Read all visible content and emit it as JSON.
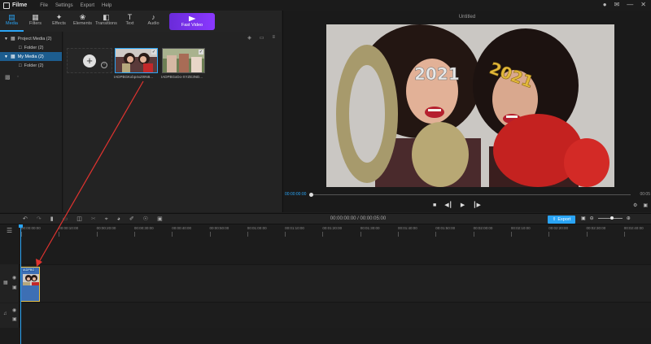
{
  "app": {
    "name": "Filme"
  },
  "menu": [
    "File",
    "Settings",
    "Export",
    "Help"
  ],
  "window_controls": [
    "user-icon",
    "mail-icon",
    "minimize-icon",
    "close-icon"
  ],
  "tabs": [
    {
      "label": "Media",
      "icon": "media-icon",
      "active": true
    },
    {
      "label": "Filters",
      "icon": "filters-icon",
      "active": false
    },
    {
      "label": "Effects",
      "icon": "effects-icon",
      "active": false
    },
    {
      "label": "Elements",
      "icon": "elements-icon",
      "active": false
    },
    {
      "label": "Transitions",
      "icon": "transitions-icon",
      "active": false
    },
    {
      "label": "Text",
      "icon": "text-icon",
      "active": false
    },
    {
      "label": "Audio",
      "icon": "audio-icon",
      "active": false
    }
  ],
  "fast_video": {
    "label": "Fast Video"
  },
  "tree": {
    "project_media": "Project Media (2)",
    "project_folder": "Folder (2)",
    "my_media": "My Media (2)",
    "my_folder": "Folder (2)"
  },
  "media": {
    "clips": [
      {
        "label": "IADPBGKxbp4xZI9N8..."
      },
      {
        "label": "IADPBGxDo-XYZE3ND..."
      }
    ]
  },
  "preview": {
    "title": "Untitled",
    "time_current": "00:00:00:00",
    "time_end": "00:05"
  },
  "timeline": {
    "time_display": "00:00:00:00 / 00:00:05:00",
    "export_label": "Export",
    "ruler": [
      "00:00:00:00",
      "00:00:10:00",
      "00:00:20:00",
      "00:00:30:00",
      "00:00:40:00",
      "00:00:50:00",
      "00:01:00:00",
      "00:01:10:00",
      "00:01:20:00",
      "00:01:30:00",
      "00:01:40:00",
      "00:01:50:00",
      "00:02:00:00",
      "00:02:10:00",
      "00:02:20:00",
      "00:02:30:00",
      "00:02:40:00"
    ],
    "clip_label": "IADPBG"
  },
  "colors": {
    "accent": "#2aa4f5",
    "selection": "#1d5d8f",
    "fast_video": "#7a33ee",
    "arrow": "#e0332f"
  }
}
